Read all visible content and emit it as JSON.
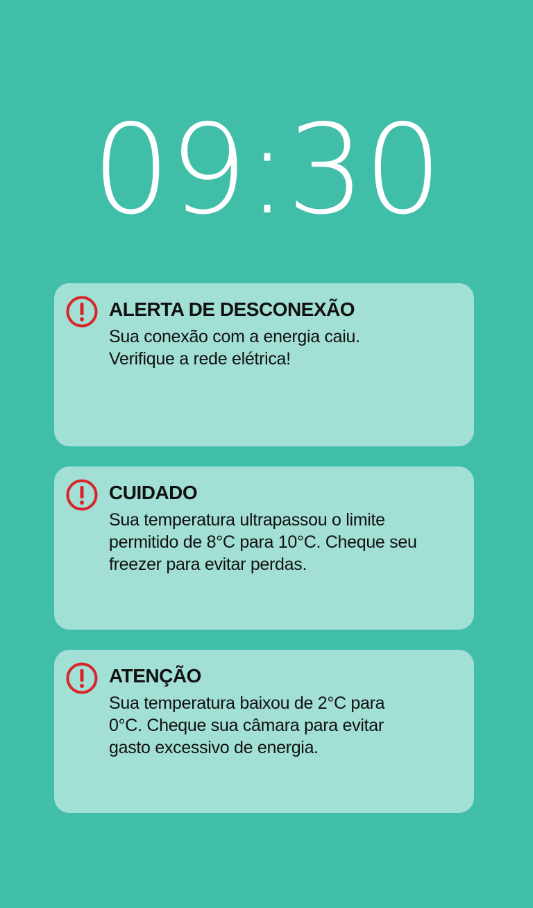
{
  "lock_screen": {
    "time": "09:30"
  },
  "colors": {
    "background": "#41bea7",
    "card": "#a2dfd4",
    "alert_icon": "#d9252a",
    "clock_text": "#ffffff"
  },
  "notifications": [
    {
      "icon": "alert-icon",
      "title": "ALERTA DE DESCONEXÃO",
      "message": "Sua conexão com a energia caiu. Verifique a rede elétrica!"
    },
    {
      "icon": "alert-icon",
      "title": "CUIDADO",
      "message": "Sua temperatura ultrapassou o limite permitido de 8°C para 10°C. Cheque seu freezer para evitar perdas."
    },
    {
      "icon": "alert-icon",
      "title": "ATENÇÃO",
      "message": "Sua temperatura baixou de 2°C para 0°C. Cheque sua câmara para evitar gasto excessivo de energia."
    }
  ]
}
